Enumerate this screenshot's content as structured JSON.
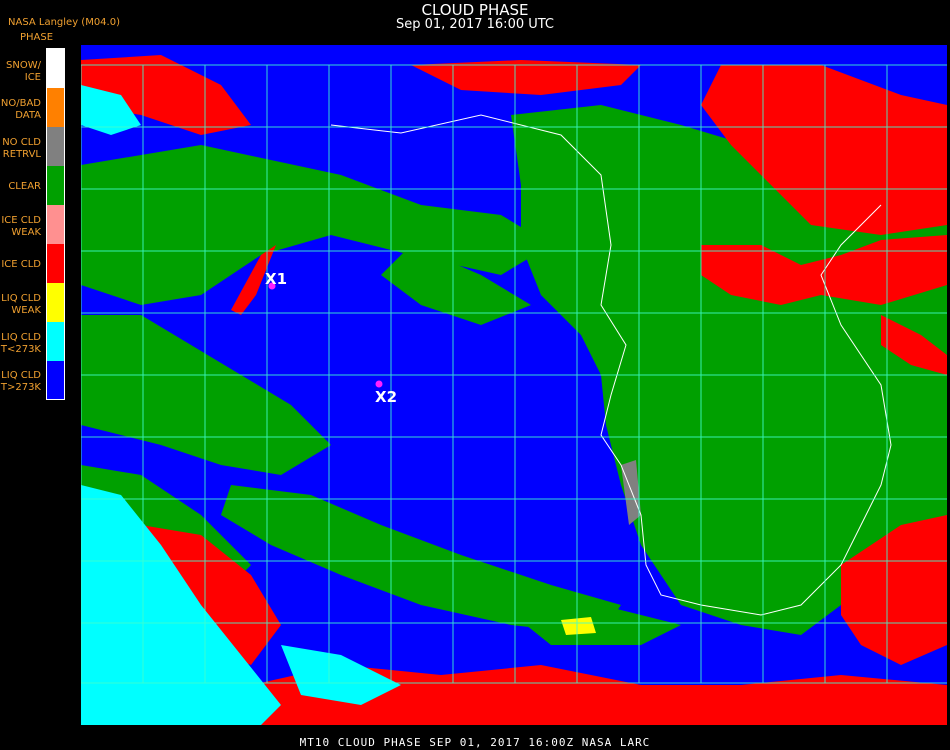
{
  "header": {
    "title": "CLOUD PHASE",
    "subtitle": "Sep 01, 2017 16:00 UTC",
    "credit": "NASA Langley (M04.0)"
  },
  "legend": {
    "title": "PHASE",
    "items": [
      {
        "label": "SNOW/\nICE",
        "color": "#ffffff"
      },
      {
        "label": "NO/BAD\nDATA",
        "color": "#ff8000"
      },
      {
        "label": "NO CLD\nRETRVL",
        "color": "#808080"
      },
      {
        "label": "CLEAR",
        "color": "#00a000"
      },
      {
        "label": "ICE CLD\nWEAK",
        "color": "#ff9090"
      },
      {
        "label": "ICE CLD",
        "color": "#ff0000"
      },
      {
        "label": "LIQ CLD\nWEAK",
        "color": "#ffff00"
      },
      {
        "label": "LIQ CLD\nT<273K",
        "color": "#00ffff"
      },
      {
        "label": "LIQ CLD\nT>273K",
        "color": "#0000ff"
      }
    ]
  },
  "markers": [
    {
      "label": "X1"
    },
    {
      "label": "X2"
    }
  ],
  "footer": "MT10  CLOUD PHASE  SEP 01, 2017 16:00Z  NASA LARC",
  "colors": {
    "background": "#000000",
    "grid": "#40ffd0",
    "coast": "#ffffff",
    "marker": "#ff20ff"
  }
}
